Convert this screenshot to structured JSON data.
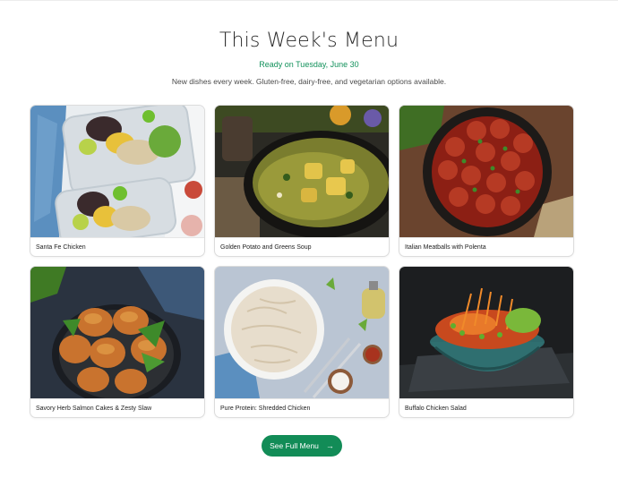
{
  "header": {
    "title": "This Week's Menu",
    "ready": "Ready on Tuesday, June 30",
    "description": "New dishes every week. Gluten-free, dairy-free, and vegetarian options available."
  },
  "menu": {
    "items": [
      {
        "name": "Santa Fe Chicken",
        "image": "meal-prep-containers-photo"
      },
      {
        "name": "Golden Potato and Greens Soup",
        "image": "potato-greens-soup-photo"
      },
      {
        "name": "Italian Meatballs with Polenta",
        "image": "meatballs-pan-photo"
      },
      {
        "name": "Savory Herb Salmon Cakes & Zesty Slaw",
        "image": "salmon-cakes-photo"
      },
      {
        "name": "Pure Protein: Shredded Chicken",
        "image": "shredded-chicken-bowl-photo"
      },
      {
        "name": "Buffalo Chicken Salad",
        "image": "buffalo-chicken-salad-photo"
      }
    ]
  },
  "cta": {
    "label": "See Full Menu",
    "icon": "arrow-right-icon"
  },
  "colors": {
    "accent": "#128c57",
    "ready_text": "#12915b"
  }
}
